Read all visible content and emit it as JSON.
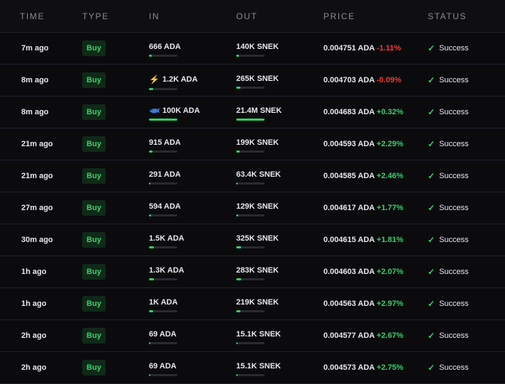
{
  "headers": {
    "time": "TIME",
    "type": "TYPE",
    "in": "IN",
    "out": "OUT",
    "price": "PRICE",
    "status": "STATUS"
  },
  "colors": {
    "buy_bg": "#0f2a18",
    "buy_text": "#39d265",
    "positive": "#35d36a",
    "negative": "#ef3b3b"
  },
  "rows": [
    {
      "time": "7m ago",
      "type": "Buy",
      "in": "666 ADA",
      "out": "140K SNEK",
      "price": "0.004751 ADA",
      "change": "-1.11%",
      "status": "Success",
      "icon": ""
    },
    {
      "time": "8m ago",
      "type": "Buy",
      "in": "1.2K ADA",
      "out": "265K SNEK",
      "price": "0.004703 ADA",
      "change": "-0.09%",
      "status": "Success",
      "icon": "bolt-icon"
    },
    {
      "time": "8m ago",
      "type": "Buy",
      "in": "100K ADA",
      "out": "21.4M SNEK",
      "price": "0.004683 ADA",
      "change": "+0.32%",
      "status": "Success",
      "icon": "whale-icon"
    },
    {
      "time": "21m ago",
      "type": "Buy",
      "in": "915 ADA",
      "out": "199K SNEK",
      "price": "0.004593 ADA",
      "change": "+2.29%",
      "status": "Success",
      "icon": ""
    },
    {
      "time": "21m ago",
      "type": "Buy",
      "in": "291 ADA",
      "out": "63.4K SNEK",
      "price": "0.004585 ADA",
      "change": "+2.46%",
      "status": "Success",
      "icon": ""
    },
    {
      "time": "27m ago",
      "type": "Buy",
      "in": "594 ADA",
      "out": "129K SNEK",
      "price": "0.004617 ADA",
      "change": "+1.77%",
      "status": "Success",
      "icon": ""
    },
    {
      "time": "30m ago",
      "type": "Buy",
      "in": "1.5K ADA",
      "out": "325K SNEK",
      "price": "0.004615 ADA",
      "change": "+1.81%",
      "status": "Success",
      "icon": ""
    },
    {
      "time": "1h ago",
      "type": "Buy",
      "in": "1.3K ADA",
      "out": "283K SNEK",
      "price": "0.004603 ADA",
      "change": "+2.07%",
      "status": "Success",
      "icon": ""
    },
    {
      "time": "1h ago",
      "type": "Buy",
      "in": "1K ADA",
      "out": "219K SNEK",
      "price": "0.004563 ADA",
      "change": "+2.97%",
      "status": "Success",
      "icon": ""
    },
    {
      "time": "2h ago",
      "type": "Buy",
      "in": "69 ADA",
      "out": "15.1K SNEK",
      "price": "0.004577 ADA",
      "change": "+2.67%",
      "status": "Success",
      "icon": ""
    },
    {
      "time": "2h ago",
      "type": "Buy",
      "in": "69 ADA",
      "out": "15.1K SNEK",
      "price": "0.004573 ADA",
      "change": "+2.75%",
      "status": "Success",
      "icon": ""
    }
  ],
  "volume_fractions": [
    0.1,
    0.15,
    1.0,
    0.12,
    0.06,
    0.08,
    0.18,
    0.18,
    0.14,
    0.03,
    0.03
  ]
}
